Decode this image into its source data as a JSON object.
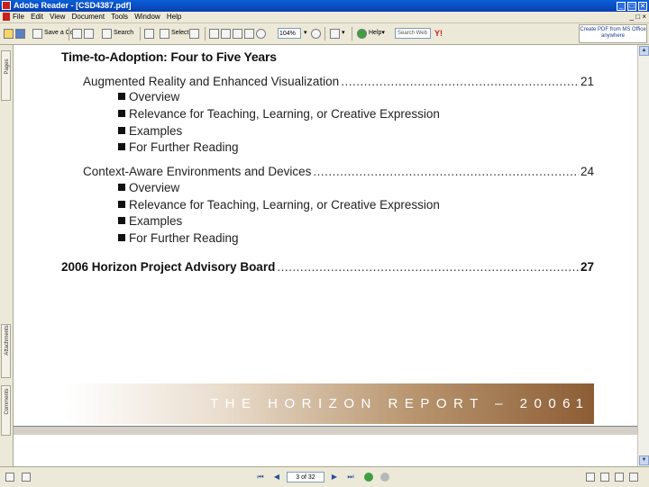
{
  "window": {
    "title": "Adobe Reader - [CSD4387.pdf]",
    "controls": [
      "_",
      "□",
      "×"
    ]
  },
  "menu": {
    "items": [
      "File",
      "Edit",
      "View",
      "Document",
      "Tools",
      "Window",
      "Help"
    ],
    "mdi_controls": "_ □ ×"
  },
  "toolbar": {
    "save_copy_label": "Save a Copy",
    "search_label": "Search",
    "select_label": "Select",
    "zoom_value": "104%",
    "help_label": "Help",
    "search_placeholder": "Search Web",
    "promo_text": "Create PDF from MS Office anywhere"
  },
  "nav_tabs": [
    "Pages",
    "Attachments",
    "Comments"
  ],
  "document": {
    "section_heading": "Time-to-Adoption: Four to Five Years",
    "entries": [
      {
        "title": "Augmented Reality and Enhanced Visualization",
        "page": "21",
        "subitems": [
          "Overview",
          "Relevance for Teaching, Learning, or Creative Expression",
          "Examples",
          "For Further Reading"
        ]
      },
      {
        "title": "Context-Aware Environments and Devices",
        "page": "24",
        "subitems": [
          "Overview",
          "Relevance for Teaching, Learning, or Creative Expression",
          "Examples",
          "For Further Reading"
        ]
      }
    ],
    "board": {
      "title": "2006 Horizon Project Advisory Board",
      "page": "27"
    },
    "banner": {
      "text": "THE HORIZON REPORT – 2006",
      "page_number": "1"
    }
  },
  "status": {
    "page_indicator": "3 of 32"
  },
  "colors": {
    "title_bar": "#0a4fcc",
    "banner_end": "#8c5d35"
  }
}
